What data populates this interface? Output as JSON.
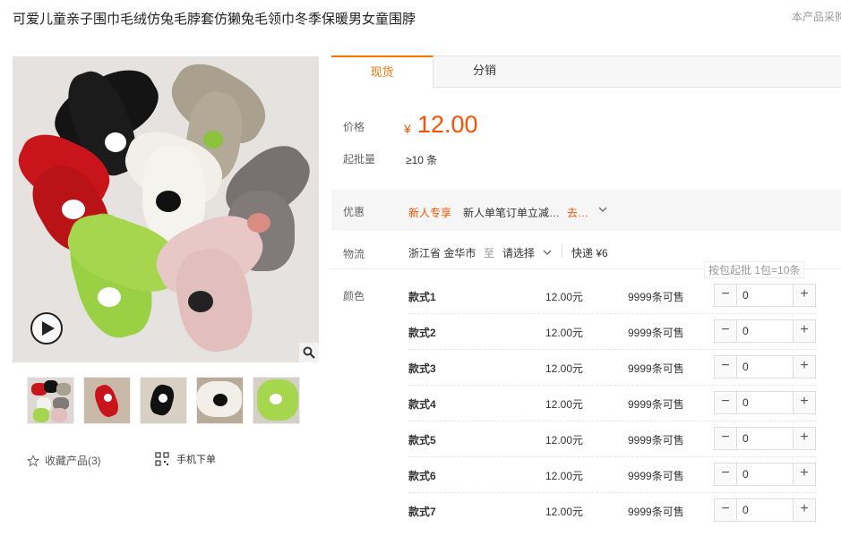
{
  "product": {
    "title": "可爱儿童亲子围巾毛绒仿兔毛脖套仿獭兔毛领巾冬季保暖男女童围脖",
    "corner_note": "本产品采购"
  },
  "gallery": {
    "favorite_label": "收藏产品(3)",
    "mobile_order_label": "手机下单"
  },
  "tabs": [
    {
      "label": "现货"
    },
    {
      "label": "分销"
    }
  ],
  "pricing": {
    "price_label": "价格",
    "currency": "¥",
    "price": "12.00",
    "moq_label": "起批量",
    "moq_value": "≥10 条"
  },
  "promo": {
    "label": "优惠",
    "tag": "新人专享",
    "text": "新人单笔订单立减…",
    "go": "去…"
  },
  "shipping": {
    "label": "物流",
    "from": "浙江省 金华市",
    "to_word": "至",
    "select": "请选择",
    "fee": "快递 ¥6"
  },
  "pack_note": "按包起批 1包=10条",
  "color_label": "颜色",
  "skus": [
    {
      "name": "款式1",
      "price": "12.00元",
      "stock": "9999条可售",
      "qty": "0"
    },
    {
      "name": "款式2",
      "price": "12.00元",
      "stock": "9999条可售",
      "qty": "0"
    },
    {
      "name": "款式3",
      "price": "12.00元",
      "stock": "9999条可售",
      "qty": "0"
    },
    {
      "name": "款式4",
      "price": "12.00元",
      "stock": "9999条可售",
      "qty": "0"
    },
    {
      "name": "款式5",
      "price": "12.00元",
      "stock": "9999条可售",
      "qty": "0"
    },
    {
      "name": "款式6",
      "price": "12.00元",
      "stock": "9999条可售",
      "qty": "0"
    },
    {
      "name": "款式7",
      "price": "12.00元",
      "stock": "9999条可售",
      "qty": "0"
    }
  ],
  "stepper_symbols": {
    "minus": "−",
    "plus": "+"
  },
  "colors": {
    "accent": "#ff7300",
    "price": "#ff5000"
  }
}
